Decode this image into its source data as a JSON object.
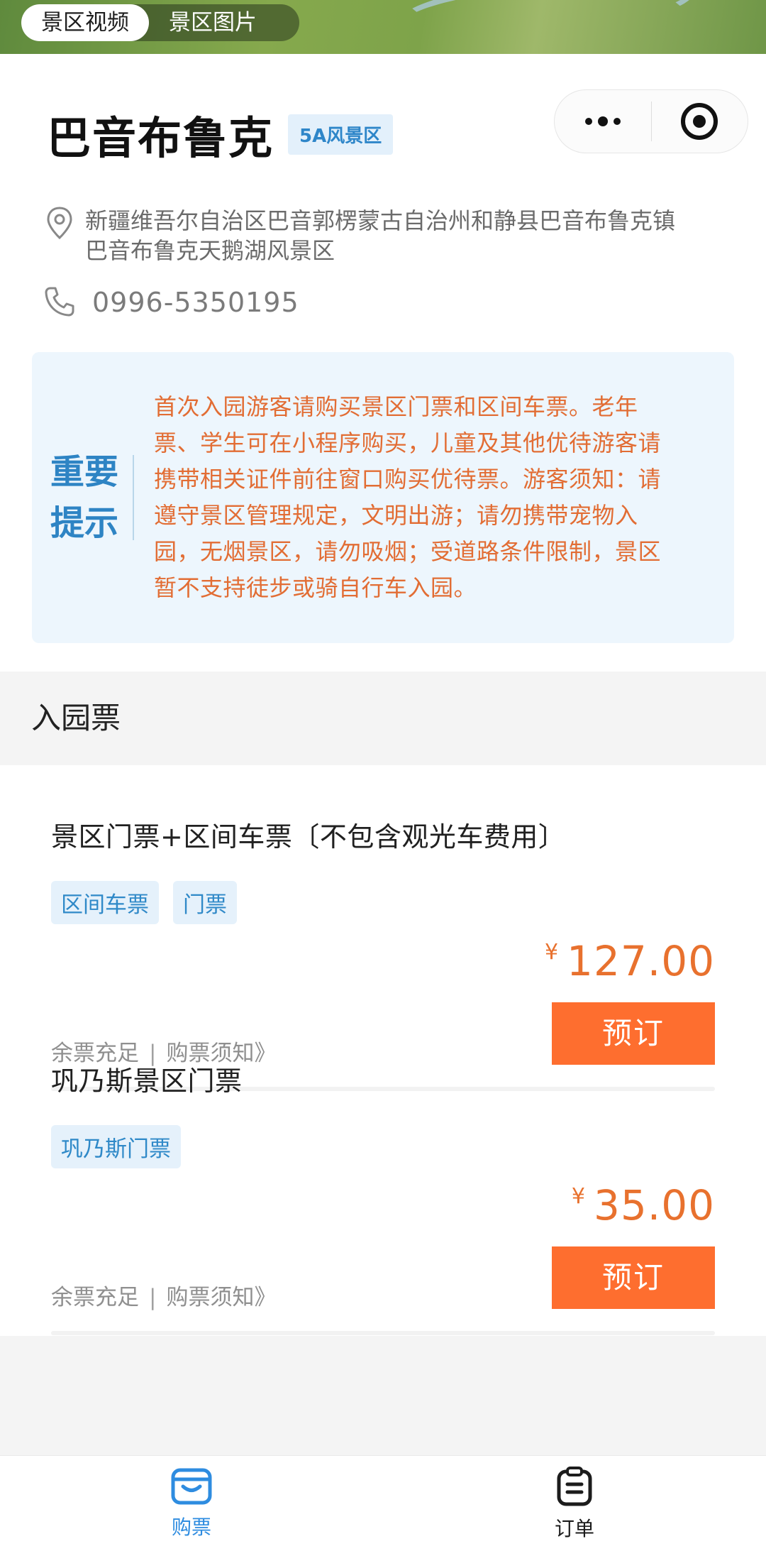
{
  "media_toggle": {
    "tabs": [
      {
        "label": "景区视频",
        "active": true
      },
      {
        "label": "景区图片",
        "active": false
      }
    ]
  },
  "capsule": {
    "more_icon": "more-dots-icon",
    "close_icon": "target-close-icon"
  },
  "scenic": {
    "name": "巴音布鲁克",
    "level_badge": "5A风景区",
    "address_line1": "新疆维吾尔自治区巴音郭楞蒙古自治州和静县巴音布鲁克镇",
    "address_line2": "巴音布鲁克天鹅湖风景区",
    "phone": "0996-5350195"
  },
  "notice": {
    "heading_line1": "重要",
    "heading_line2": "提示",
    "lines": [
      "首次入园游客请购买景区门票和区间车票。老年",
      "票、学生可在小程序购买，儿童及其他优待游客请",
      "携带相关证件前往窗口购买优待票。游客须知：请",
      "遵守景区管理规定，文明出游；请勿携带宠物入",
      "园，无烟景区，请勿吸烟；受道路条件限制，景区",
      "暂不支持徒步或骑自行车入园。"
    ]
  },
  "section": {
    "title": "入园票"
  },
  "tickets": [
    {
      "name": "景区门票+区间车票〔不包含观光车费用〕",
      "tags": [
        "区间车票",
        "门票"
      ],
      "currency": "¥",
      "price": "127.00",
      "stock": "余票充足",
      "separator": "|",
      "notice_link": "购票须知》",
      "book_label": "预订"
    },
    {
      "name": "巩乃斯景区门票",
      "tags": [
        "巩乃斯门票"
      ],
      "currency": "¥",
      "price": "35.00",
      "stock": "余票充足",
      "separator": "|",
      "notice_link": "购票须知》",
      "book_label": "预订"
    }
  ],
  "tabbar": {
    "items": [
      {
        "label": "购票",
        "icon": "shop-icon",
        "active": true
      },
      {
        "label": "订单",
        "icon": "clipboard-icon",
        "active": false
      }
    ]
  },
  "colors": {
    "accent_blue": "#2e8ce0",
    "price_orange": "#e8712e",
    "button_orange": "#fe6e2f"
  }
}
